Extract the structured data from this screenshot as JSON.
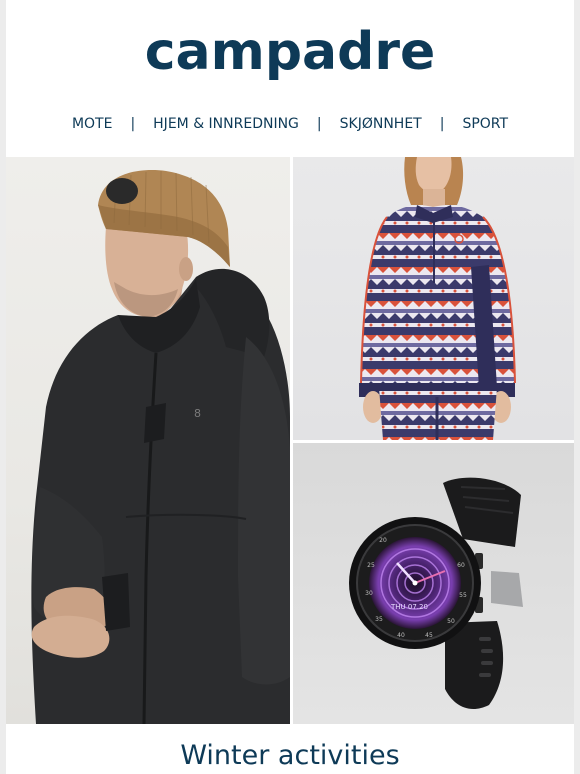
{
  "brand": {
    "name": "campadre",
    "color": "#0e3a57"
  },
  "nav": {
    "items": [
      {
        "label": "MOTE"
      },
      {
        "label": "HJEM & INNREDNING"
      },
      {
        "label": "SKJØNNHET"
      },
      {
        "label": "SPORT"
      }
    ],
    "separator": "|"
  },
  "products": [
    {
      "name": "winter-jacket",
      "icon": "jacket-and-beanie-photo"
    },
    {
      "name": "patterned-base-layer",
      "icon": "knit-sweater-photo"
    },
    {
      "name": "smartwatch",
      "icon": "smartwatch-photo"
    }
  ],
  "watch": {
    "date": "THU 07.20",
    "bezel": [
      "20",
      "25",
      "30",
      "35",
      "40",
      "45",
      "50",
      "55",
      "60"
    ]
  },
  "section": {
    "title": "Winter activities"
  }
}
